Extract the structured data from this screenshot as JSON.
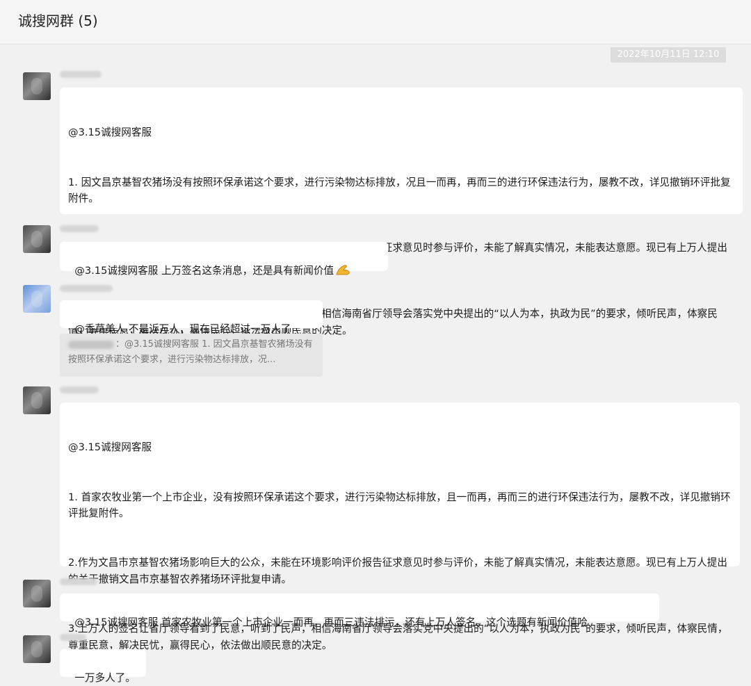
{
  "header": {
    "title": "诚搜网群 (5)"
  },
  "timestamp": "2022年10月11日 12:10",
  "messages": [
    {
      "lines": [
        "@3.15诚搜网客服",
        "1. 因文昌京基智农猪场没有按照环保承诺这个要求，进行污染物达标排放，况且一而再，再而三的进行环保违法行为，屡教不改，详见撤销环评批复附件。",
        "2.作为文昌市京基智农猪场影响巨大的公众，未能在环境影响评价报告征求意见时参与评价，未能了解真实情况，未能表达意愿。现已有上万人提出的关于撤销文昌市京基智农养猪场环评批复申请。",
        "3.已近万人的签名让省厅领导看到了民意，听到了民声，相信海南省厅领导会落实党中央提出的“以人为本，执政为民”的要求，倾听民声，体察民情，尊重民意，解决民忧，赢得民心，依法做出顺民意的决定。"
      ]
    },
    {
      "text": "@3.15诚搜网客服 上万签名这条消息，还是具有新闻价值",
      "emoji": "muscle-emoji"
    },
    {
      "text": "@香草美人 不是近万人，现在已经超过一万人了",
      "quote": "：@3.15诚搜网客服 1. 因文昌京基智农猪场没有按照环保承诺这个要求，进行污染物达标排放，况..."
    },
    {
      "lines": [
        "@3.15诚搜网客服",
        "1. 首家农牧业第一个上市企业，没有按照环保承诺这个要求，进行污染物达标排放，且一而再，再而三的进行环保违法行为，屡教不改，详见撤销环评批复附件。",
        "2.作为文昌市京基智农猪场影响巨大的公众，未能在环境影响评价报告征求意见时参与评价，未能了解真实情况，未能表达意愿。现已有上万人提出的关于撤销文昌市京基智农养猪场环评批复申请。",
        "3.上万人的签名让省厅领导看到了民意，听到了民声，相信海南省厅领导会落实党中央提出的“以人为本，执政为民”的要求，倾听民声，体察民情，尊重民意，解决民忧，赢得民心，依法做出顺民意的决定。"
      ]
    },
    {
      "text": "@3.15诚搜网客服 首家农牧业第一个上市企业一而再，再而三违法排污，还有上万人签名。这个选题有新闻价值哈"
    },
    {
      "text": "一万多人了。"
    }
  ]
}
